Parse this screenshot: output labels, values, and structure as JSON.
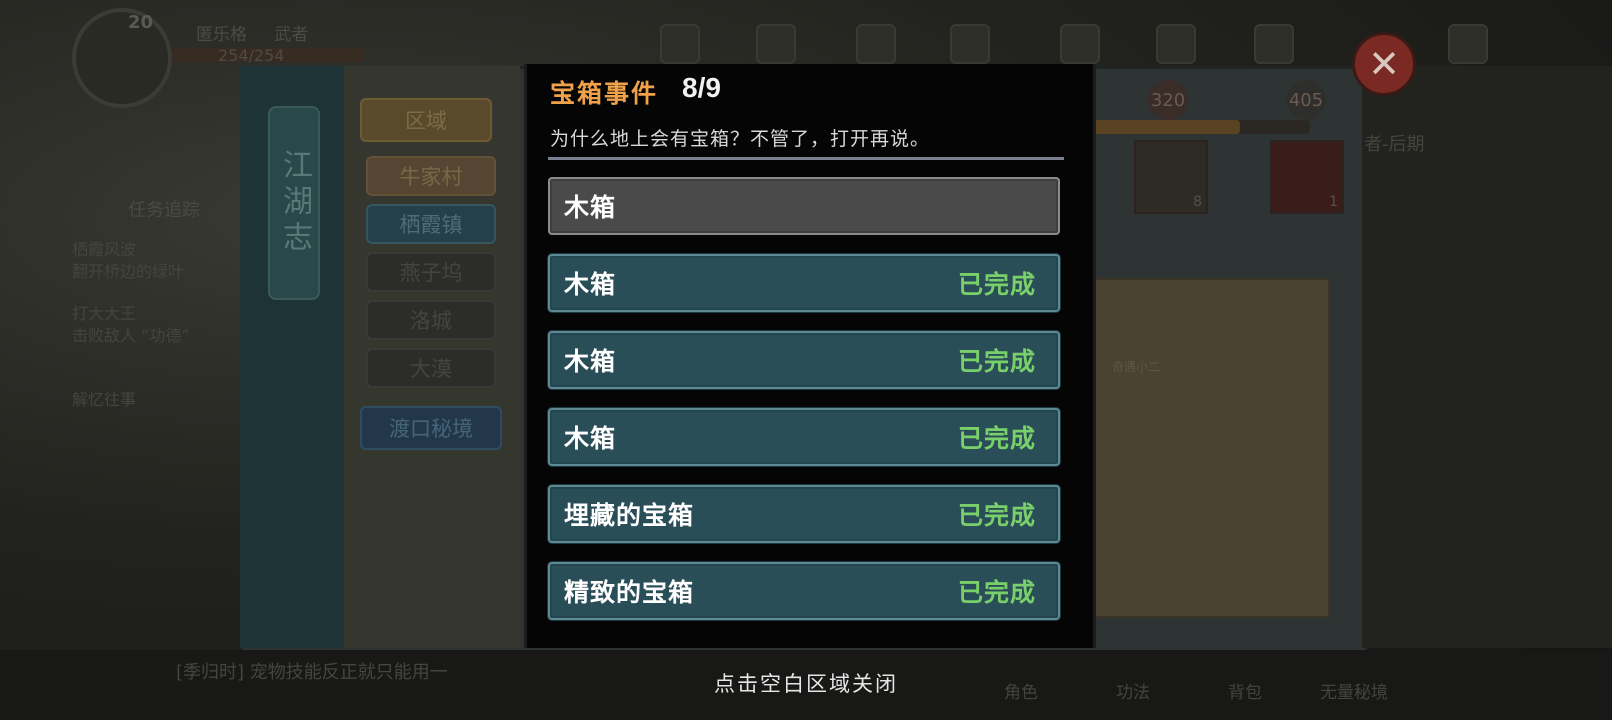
{
  "background": {
    "player": {
      "level": "20",
      "name": "匿乐格",
      "title": "武者",
      "hp": "254/254"
    },
    "task_tracker": {
      "title": "任务追踪",
      "lines": [
        "栖霞风波",
        "翻开桥边的绿叶",
        "打大大王",
        "击败敌人 “功德”",
        "解忆往事"
      ]
    },
    "map": {
      "banner": "江湖志",
      "region_button": "区域",
      "areas": [
        "牛家村",
        "栖霞镇",
        "燕子坞",
        "洛城",
        "大漠"
      ],
      "secret_button": "渡口秘境",
      "stat_left": "320",
      "stat_right": "405",
      "card_count_1": "8",
      "card_count_2": "1",
      "side_note": "者-后期",
      "npc_label": "奇遇小二"
    },
    "chat_preview": "[季归时] 宠物技能反正就只能用一",
    "bottom_nav": [
      "角色",
      "功法",
      "背包",
      "无量秘境"
    ],
    "close_icon_glyph": "✕"
  },
  "modal": {
    "title": "宝箱事件",
    "progress": "8/9",
    "description": "为什么地上会有宝箱？不管了，打开再说。",
    "chests": [
      {
        "name": "木箱",
        "status": ""
      },
      {
        "name": "木箱",
        "status": "已完成"
      },
      {
        "name": "木箱",
        "status": "已完成"
      },
      {
        "name": "木箱",
        "status": "已完成"
      },
      {
        "name": "埋藏的宝箱",
        "status": "已完成"
      },
      {
        "name": "精致的宝箱",
        "status": "已完成"
      }
    ]
  },
  "close_hint": "点击空白区域关闭",
  "colors": {
    "title_accent": "#f0a24a",
    "completed_green": "#79d06a",
    "row_done_bg": "#2a4e58",
    "row_todo_bg": "#4a4a4a"
  }
}
